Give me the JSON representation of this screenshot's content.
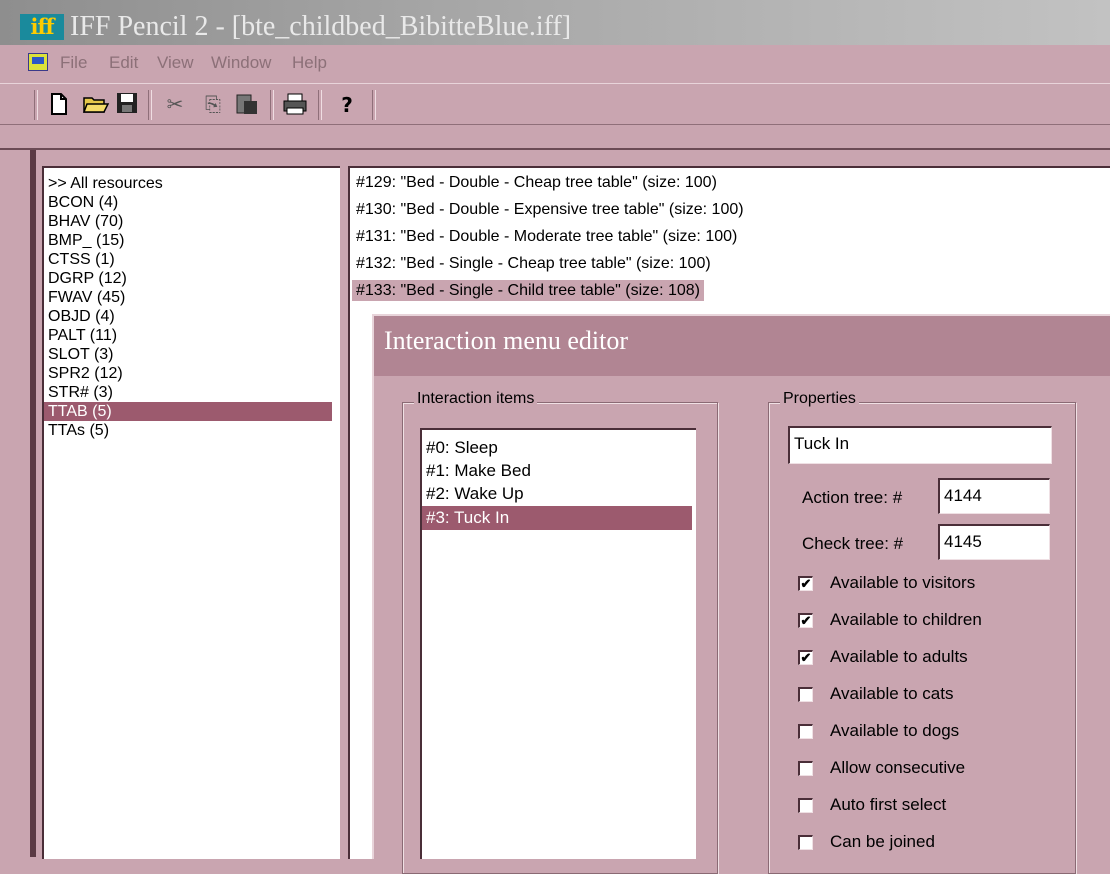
{
  "window": {
    "title": "IFF Pencil 2 - [bte_childbed_BibitteBlue.iff]",
    "app_icon_text": "iff"
  },
  "menu": [
    "File",
    "Edit",
    "View",
    "Window",
    "Help"
  ],
  "toolbar": {
    "icons": [
      "new-file-icon",
      "open-folder-icon",
      "save-icon",
      "cut-icon",
      "copy-icon",
      "paste-icon",
      "print-icon",
      "help-icon"
    ]
  },
  "resources": [
    ">> All resources",
    "BCON (4)",
    "BHAV (70)",
    "BMP_ (15)",
    "CTSS (1)",
    "DGRP (12)",
    "FWAV (45)",
    "OBJD (4)",
    "PALT (11)",
    "SLOT (3)",
    "SPR2 (12)",
    "STR# (3)",
    "TTAB (5)",
    "TTAs (5)"
  ],
  "resources_selected_index": 12,
  "tables": [
    "#129: \"Bed - Double - Cheap tree table\" (size: 100)",
    "#130: \"Bed - Double - Expensive tree table\" (size: 100)",
    "#131: \"Bed - Double - Moderate tree table\" (size: 100)",
    "#132: \"Bed - Single - Cheap tree table\" (size: 100)",
    "#133: \"Bed - Single - Child tree table\" (size: 108)"
  ],
  "tables_selected_index": 4,
  "editor": {
    "title": "Interaction menu editor",
    "items_group_label": "Interaction items",
    "items": [
      "#0: Sleep",
      "#1: Make Bed",
      "#2: Wake Up",
      "#3: Tuck In"
    ],
    "items_selected_index": 3,
    "properties_group_label": "Properties",
    "name_value": "Tuck In",
    "action_tree_label": "Action tree: #",
    "action_tree_value": "4144",
    "check_tree_label": "Check tree: #",
    "check_tree_value": "4145",
    "checkboxes": [
      {
        "label": "Available to visitors",
        "checked": true
      },
      {
        "label": "Available to children",
        "checked": true
      },
      {
        "label": "Available to adults",
        "checked": true
      },
      {
        "label": "Available to cats",
        "checked": false
      },
      {
        "label": "Available to dogs",
        "checked": false
      },
      {
        "label": "Allow consecutive",
        "checked": false
      },
      {
        "label": "Auto first select",
        "checked": false
      },
      {
        "label": "Can be joined",
        "checked": false
      }
    ]
  },
  "colors": {
    "background": "#c9a5b0",
    "selection": "#9c5a6e",
    "title_gradient_start": "#8e8e8e"
  }
}
